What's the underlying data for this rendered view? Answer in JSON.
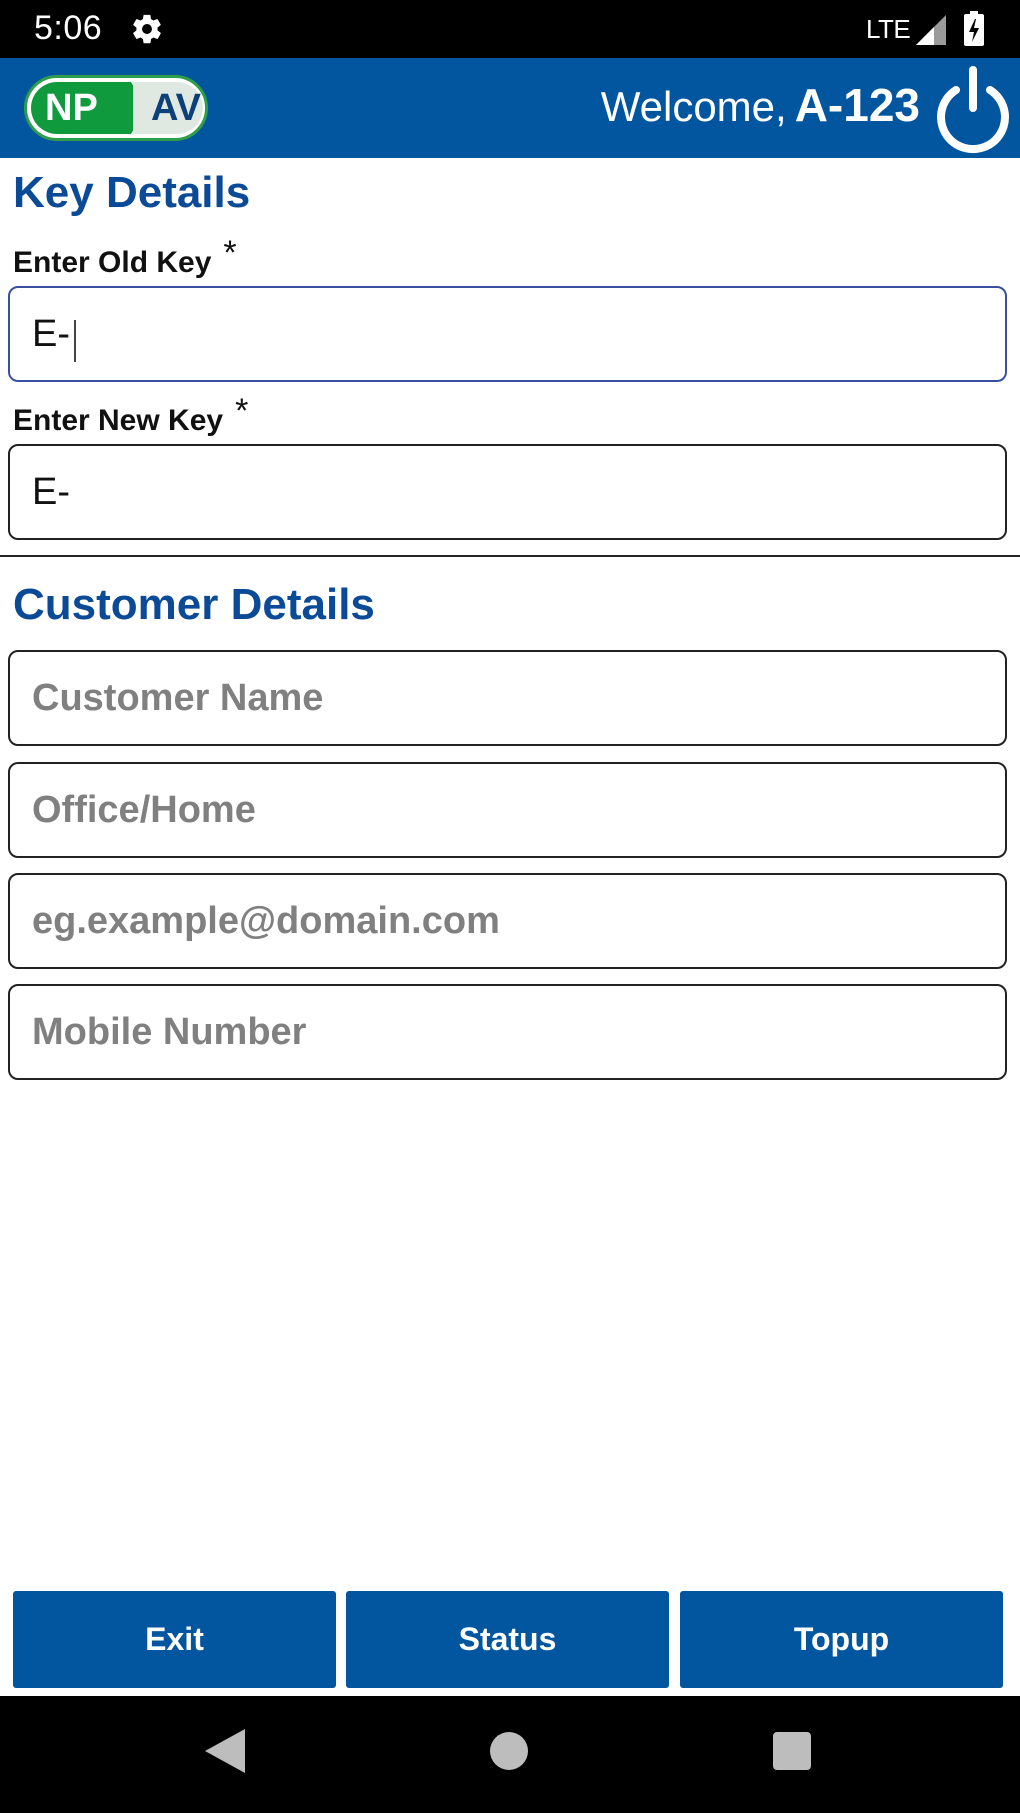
{
  "status_bar": {
    "time": "5:06",
    "network": "LTE",
    "icons": [
      "gear-icon",
      "signal-icon",
      "battery-icon"
    ]
  },
  "header": {
    "logo_left": "NP",
    "logo_right": "AV",
    "welcome_label": "Welcome,",
    "user_id": "A-123",
    "power_icon": "power-icon",
    "background_color": "#02559f"
  },
  "key_details": {
    "title": "Key Details",
    "old_key": {
      "label": "Enter Old Key",
      "required_mark": "*",
      "value": "E-"
    },
    "new_key": {
      "label": "Enter New Key",
      "required_mark": "*",
      "value": "E-"
    }
  },
  "customer_details": {
    "title": "Customer Details",
    "name_placeholder": "Customer Name",
    "address_placeholder": "Office/Home",
    "email_placeholder": "eg.example@domain.com",
    "mobile_placeholder": "Mobile Number"
  },
  "buttons": {
    "exit": "Exit",
    "status": "Status",
    "topup": "Topup"
  },
  "nav_bar": {
    "icons": [
      "back-icon",
      "home-icon",
      "recents-icon"
    ]
  }
}
